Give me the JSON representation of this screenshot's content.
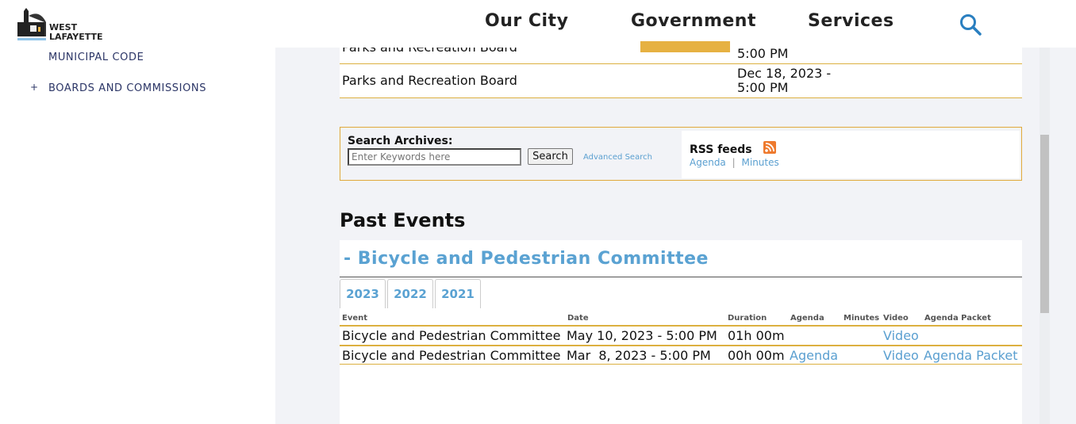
{
  "header": {
    "logo_text": "WEST LAFAYETTE",
    "nav": [
      "Our City",
      "Government",
      "Services"
    ],
    "search_icon": "search-icon",
    "accent": "#e6b142"
  },
  "sidebar": {
    "items": [
      {
        "label": "MUNICIPAL CODE"
      },
      {
        "label": "BOARDS AND COMMISSIONS",
        "expander": "+"
      }
    ]
  },
  "upcoming": {
    "rows": [
      {
        "event": "Parks and Recreation Board",
        "date_line2": "5:00 PM"
      },
      {
        "event": "Parks and Recreation Board",
        "date_line1": "Dec 18, 2023 -",
        "date_line2": "5:00 PM"
      }
    ]
  },
  "archive": {
    "label": "Search Archives:",
    "placeholder": "Enter Keywords here",
    "search_button": "Search",
    "advanced": "Advanced Search",
    "rss_title": "RSS feeds",
    "rss_links": [
      "Agenda",
      "Minutes"
    ],
    "rss_sep": "|"
  },
  "past": {
    "title": "Past Events",
    "committee": "- Bicycle and Pedestrian Committee",
    "tabs": [
      "2023",
      "2022",
      "2021"
    ],
    "columns": [
      "Event",
      "Date",
      "Duration",
      "Agenda",
      "Minutes",
      "Video",
      "Agenda Packet"
    ],
    "rows": [
      {
        "event": "Bicycle and Pedestrian Committee",
        "date": "May 10, 2023 - 5:00 PM",
        "duration": "01h 00m",
        "agenda": "",
        "minutes": "",
        "video": "Video",
        "packet": ""
      },
      {
        "event": "Bicycle and Pedestrian Committee",
        "date": "Mar  8, 2023 - 5:00 PM",
        "duration": "00h 00m",
        "agenda": "Agenda",
        "minutes": "",
        "video": "Video",
        "packet": "Agenda Packet"
      }
    ]
  }
}
